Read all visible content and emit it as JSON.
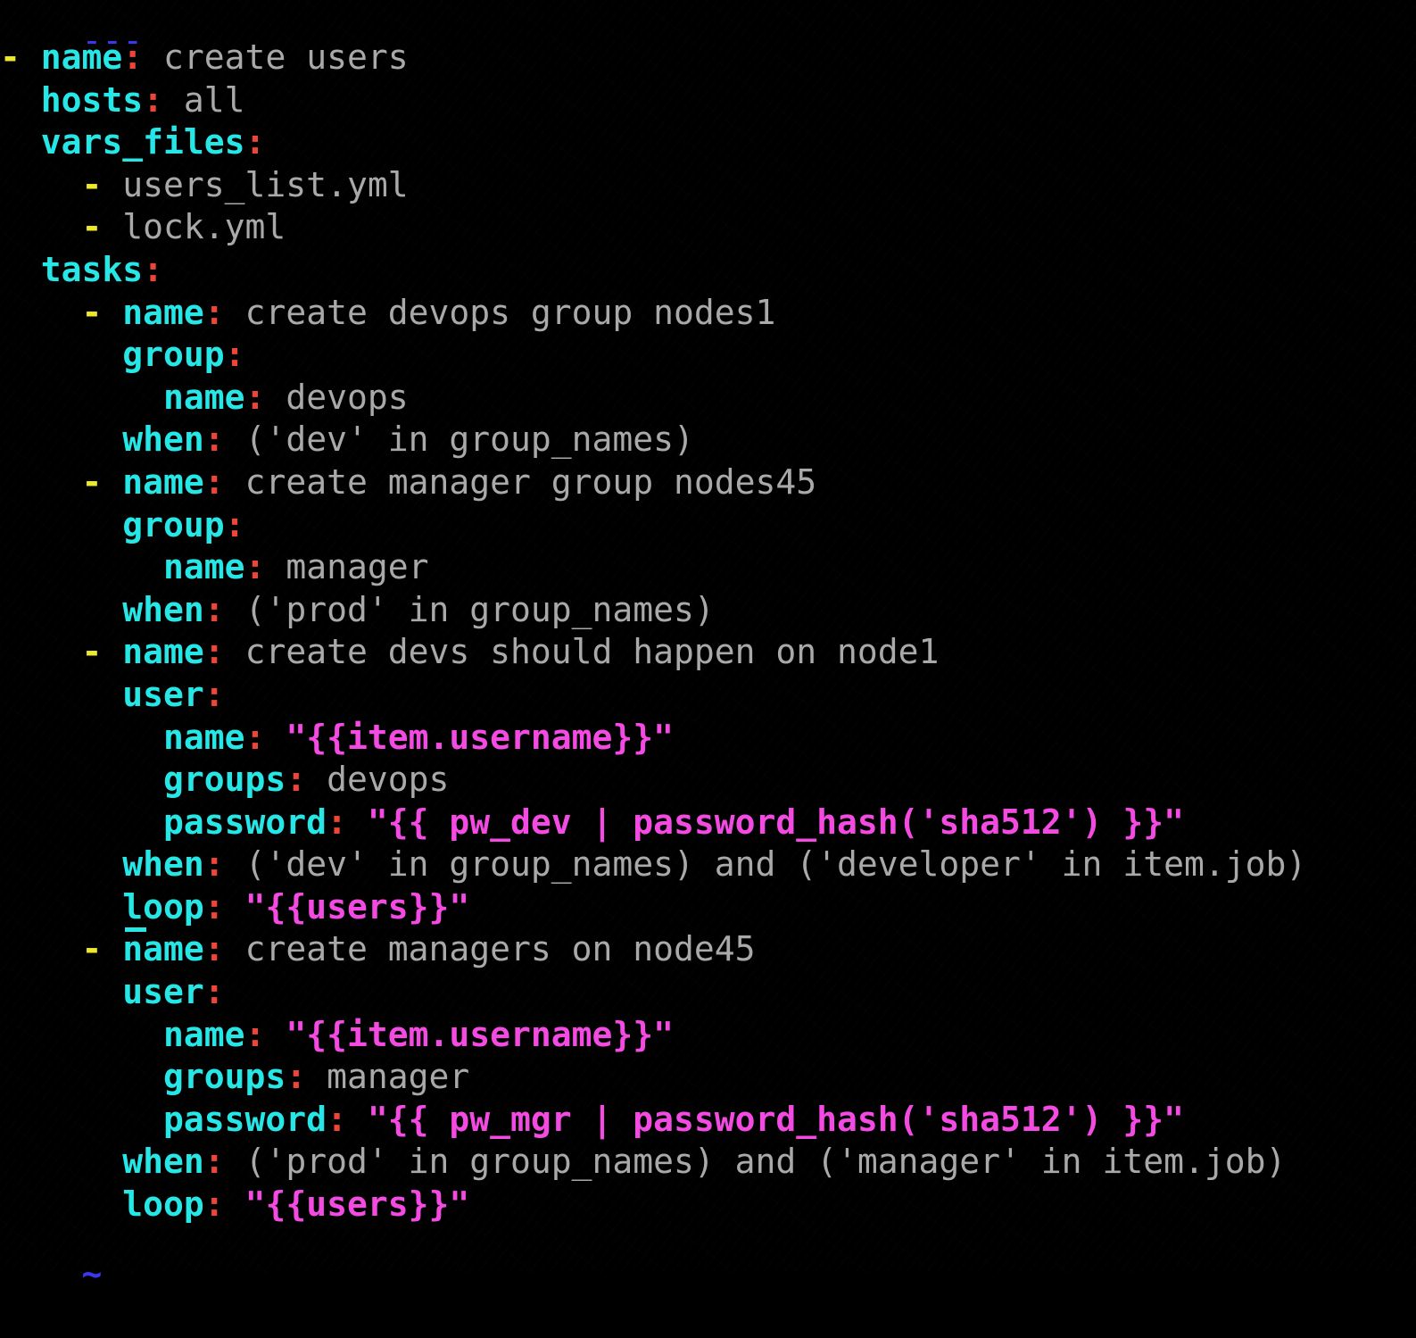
{
  "terminal": {
    "background": "#000000",
    "app": "vim",
    "file_type": "yaml",
    "colors": {
      "key": "#26e6e6",
      "colon": "#ef4438",
      "dash": "#ece92b",
      "value": "#a9a9a9",
      "string": "#f34ae2",
      "document_marker": "#3a38ef",
      "tilde": "#3a38ef",
      "cursor": "#26e6e6"
    },
    "cursor": {
      "line_index": 14,
      "column": 6,
      "shape": "underline",
      "on_token": "loop"
    }
  },
  "document_start": "---",
  "empty_marker": "~",
  "lines": [
    {
      "indent": 0,
      "dash": "- ",
      "key": "name",
      "colon": ":",
      "value": " create users",
      "value_style": "val"
    },
    {
      "indent": 2,
      "dash": "",
      "key": "hosts",
      "colon": ":",
      "value": " all",
      "value_style": "val"
    },
    {
      "indent": 2,
      "dash": "",
      "key": "vars_files",
      "colon": ":",
      "value": "",
      "value_style": "val"
    },
    {
      "indent": 4,
      "dash": "- ",
      "key": "",
      "colon": "",
      "value": "users_list.yml",
      "value_style": "val"
    },
    {
      "indent": 4,
      "dash": "- ",
      "key": "",
      "colon": "",
      "value": "lock.yml",
      "value_style": "val"
    },
    {
      "indent": 2,
      "dash": "",
      "key": "tasks",
      "colon": ":",
      "value": "",
      "value_style": "val"
    },
    {
      "indent": 4,
      "dash": "- ",
      "key": "name",
      "colon": ":",
      "value": " create devops group nodes1",
      "value_style": "val"
    },
    {
      "indent": 6,
      "dash": "",
      "key": "group",
      "colon": ":",
      "value": "",
      "value_style": "val"
    },
    {
      "indent": 8,
      "dash": "",
      "key": "name",
      "colon": ":",
      "value": " devops",
      "value_style": "val"
    },
    {
      "indent": 6,
      "dash": "",
      "key": "when",
      "colon": ":",
      "value": " ('dev' in group_names)",
      "value_style": "val"
    },
    {
      "indent": 4,
      "dash": "- ",
      "key": "name",
      "colon": ":",
      "value": " create manager group nodes45",
      "value_style": "val"
    },
    {
      "indent": 6,
      "dash": "",
      "key": "group",
      "colon": ":",
      "value": "",
      "value_style": "val"
    },
    {
      "indent": 8,
      "dash": "",
      "key": "name",
      "colon": ":",
      "value": " manager",
      "value_style": "val"
    },
    {
      "indent": 6,
      "dash": "",
      "key": "when",
      "colon": ":",
      "value": " ('prod' in group_names)",
      "value_style": "val"
    },
    {
      "indent": 4,
      "dash": "- ",
      "key": "name",
      "colon": ":",
      "value": " create devs should happen on node1",
      "value_style": "val"
    },
    {
      "indent": 6,
      "dash": "",
      "key": "user",
      "colon": ":",
      "value": "",
      "value_style": "val"
    },
    {
      "indent": 8,
      "dash": "",
      "key": "name",
      "colon": ":",
      "value": " \"{{item.username}}\"",
      "value_style": "str"
    },
    {
      "indent": 8,
      "dash": "",
      "key": "groups",
      "colon": ":",
      "value": " devops",
      "value_style": "val"
    },
    {
      "indent": 8,
      "dash": "",
      "key": "password",
      "colon": ":",
      "value": " \"{{ pw_dev | password_hash('sha512') }}\"",
      "value_style": "str"
    },
    {
      "indent": 6,
      "dash": "",
      "key": "when",
      "colon": ":",
      "value": " ('dev' in group_names) and ('developer' in item.job)",
      "value_style": "val"
    },
    {
      "indent": 6,
      "dash": "",
      "key": "loop",
      "colon": ":",
      "value": " \"{{users}}\"",
      "value_style": "str",
      "cursor": true
    },
    {
      "indent": 4,
      "dash": "- ",
      "key": "name",
      "colon": ":",
      "value": " create managers on node45",
      "value_style": "val"
    },
    {
      "indent": 6,
      "dash": "",
      "key": "user",
      "colon": ":",
      "value": "",
      "value_style": "val"
    },
    {
      "indent": 8,
      "dash": "",
      "key": "name",
      "colon": ":",
      "value": " \"{{item.username}}\"",
      "value_style": "str"
    },
    {
      "indent": 8,
      "dash": "",
      "key": "groups",
      "colon": ":",
      "value": " manager",
      "value_style": "val"
    },
    {
      "indent": 8,
      "dash": "",
      "key": "password",
      "colon": ":",
      "value": " \"{{ pw_mgr | password_hash('sha512') }}\"",
      "value_style": "str"
    },
    {
      "indent": 6,
      "dash": "",
      "key": "when",
      "colon": ":",
      "value": " ('prod' in group_names) and ('manager' in item.job)",
      "value_style": "val"
    },
    {
      "indent": 6,
      "dash": "",
      "key": "loop",
      "colon": ":",
      "value": " \"{{users}}\"",
      "value_style": "str"
    }
  ]
}
